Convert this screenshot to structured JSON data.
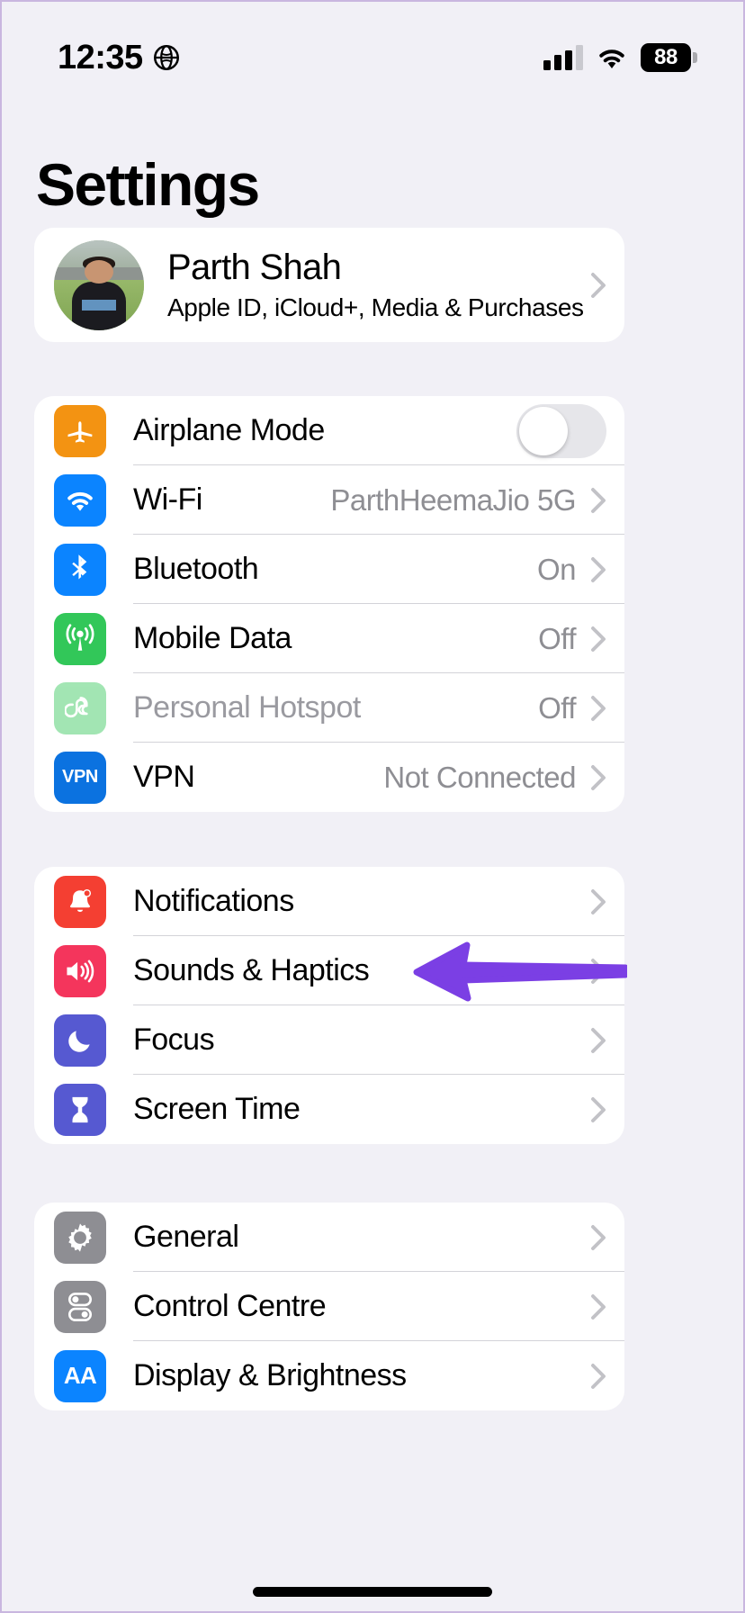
{
  "status_bar": {
    "time": "12:35",
    "location_icon": "globe-icon",
    "cellular_icon": "cellular-bars-icon",
    "wifi_icon": "wifi-icon",
    "battery_level": "88"
  },
  "header": {
    "title": "Settings"
  },
  "account": {
    "name": "Parth Shah",
    "subtitle": "Apple ID, iCloud+, Media & Purchases",
    "avatar": "profile-photo"
  },
  "groups": [
    {
      "id": "connectivity",
      "rows": [
        {
          "label": "Airplane Mode",
          "value": "",
          "icon": "airplane-icon",
          "icon_color": "#f39312",
          "accessory": "toggle",
          "toggle_on": false,
          "disabled": false
        },
        {
          "label": "Wi-Fi",
          "value": "ParthHeemaJio 5G",
          "icon": "wifi-icon",
          "icon_color": "#0b84ff",
          "accessory": "chevron",
          "disabled": false
        },
        {
          "label": "Bluetooth",
          "value": "On",
          "icon": "bluetooth-icon",
          "icon_color": "#0b84ff",
          "accessory": "chevron",
          "disabled": false
        },
        {
          "label": "Mobile Data",
          "value": "Off",
          "icon": "antenna-icon",
          "icon_color": "#32c759",
          "accessory": "chevron",
          "disabled": false
        },
        {
          "label": "Personal Hotspot",
          "value": "Off",
          "icon": "hotspot-icon",
          "icon_color": "#32c759",
          "accessory": "chevron",
          "disabled": true
        },
        {
          "label": "VPN",
          "value": "Not Connected",
          "icon": "vpn-icon",
          "icon_color": "#0b72e0",
          "accessory": "chevron",
          "disabled": false
        }
      ]
    },
    {
      "id": "alerts",
      "rows": [
        {
          "label": "Notifications",
          "value": "",
          "icon": "bell-icon",
          "icon_color": "#f43f32",
          "accessory": "chevron",
          "disabled": false
        },
        {
          "label": "Sounds & Haptics",
          "value": "",
          "icon": "speaker-icon",
          "icon_color": "#f4355c",
          "accessory": "chevron",
          "disabled": false
        },
        {
          "label": "Focus",
          "value": "",
          "icon": "moon-icon",
          "icon_color": "#5659d1",
          "accessory": "chevron",
          "disabled": false
        },
        {
          "label": "Screen Time",
          "value": "",
          "icon": "hourglass-icon",
          "icon_color": "#5659d1",
          "accessory": "chevron",
          "disabled": false
        }
      ]
    },
    {
      "id": "system",
      "rows": [
        {
          "label": "General",
          "value": "",
          "icon": "gear-icon",
          "icon_color": "#8e8e93",
          "accessory": "chevron",
          "disabled": false
        },
        {
          "label": "Control Centre",
          "value": "",
          "icon": "control-centre-icon",
          "icon_color": "#8e8e93",
          "accessory": "chevron",
          "disabled": false
        },
        {
          "label": "Display & Brightness",
          "value": "",
          "icon": "aa-icon",
          "icon_color": "#0b84ff",
          "accessory": "chevron",
          "disabled": false
        }
      ]
    }
  ],
  "annotation": {
    "arrow_icon": "left-arrow-annotation",
    "color": "#7b3fe4",
    "points_at": "Sounds & Haptics"
  },
  "home_indicator": "home-indicator-bar"
}
